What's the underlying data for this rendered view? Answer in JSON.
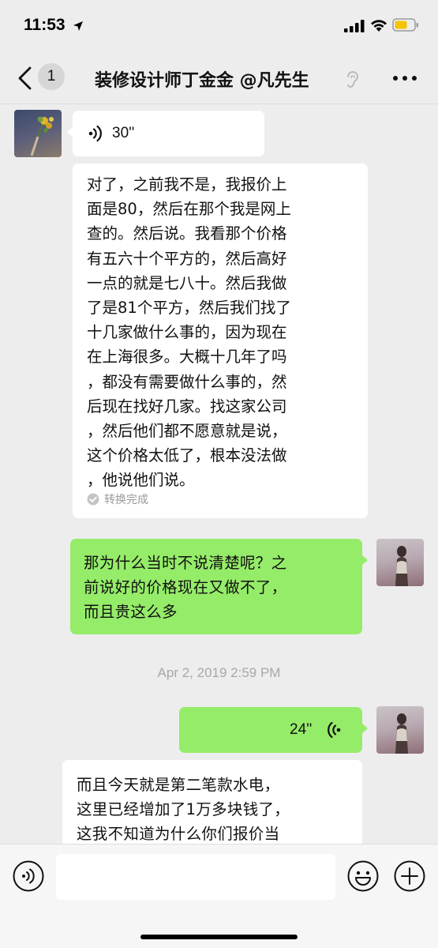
{
  "status_bar": {
    "time": "11:53"
  },
  "nav": {
    "back_count": "1",
    "title": "装修设计师丁金金 @凡先生"
  },
  "messages": {
    "voice_in": {
      "duration": "30''"
    },
    "transcript": {
      "lines": [
        "对了，之前我不是，我报价上",
        "面是80，然后在那个我是网上",
        "查的。然后说。我看那个价格",
        "有五六十个平方的，然后高好",
        "一点的就是七八十。然后我做",
        "了是81个平方，然后我们找了",
        "十几家做什么事的，因为现在",
        "在上海很多。大概十几年了吗",
        "，都没有需要做什么事的，然",
        "后现在找好几家。找这家公司",
        "，然后他们都不愿意就是说，",
        "这个价格太低了，根本没法做",
        "，他说他们说。"
      ],
      "status": "转换完成"
    },
    "outgoing_text": {
      "lines": [
        "那为什么当时不说清楚呢？之",
        "前说好的价格现在又做不了，",
        "而且贵这么多"
      ]
    },
    "timestamp": "Apr 2, 2019 2:59 PM",
    "voice_out": {
      "duration": "24''"
    },
    "partial_incoming": {
      "lines": [
        "而且今天就是第二笔款水电，",
        "这里已经增加了1万多块钱了，",
        "这我不知道为什么你们报价当"
      ]
    }
  },
  "input_bar": {
    "placeholder": ""
  }
}
